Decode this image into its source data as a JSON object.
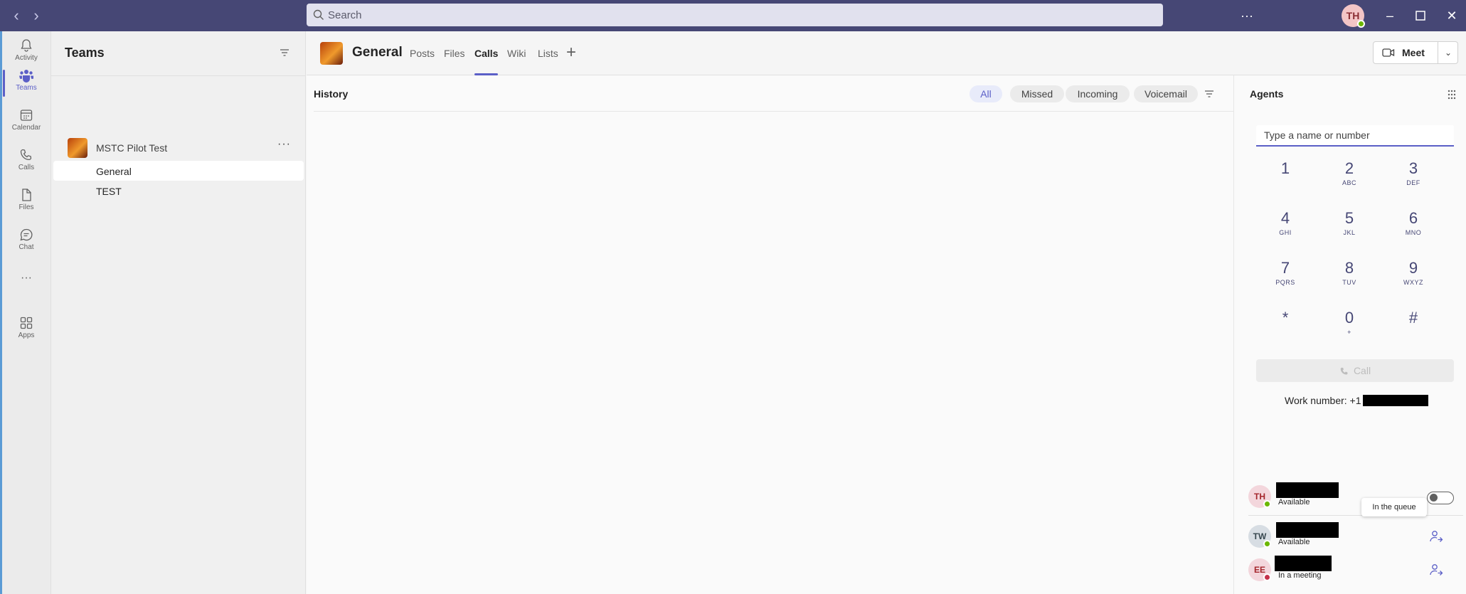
{
  "search": {
    "placeholder": "Search"
  },
  "me": {
    "initials": "TH"
  },
  "rail": [
    {
      "id": "activity",
      "label": "Activity"
    },
    {
      "id": "teams",
      "label": "Teams"
    },
    {
      "id": "calendar",
      "label": "Calendar"
    },
    {
      "id": "calls",
      "label": "Calls"
    },
    {
      "id": "files",
      "label": "Files"
    },
    {
      "id": "chat",
      "label": "Chat"
    },
    {
      "id": "more",
      "label": "···"
    },
    {
      "id": "apps",
      "label": "Apps"
    }
  ],
  "teams_pane": {
    "title": "Teams",
    "team": {
      "name": "MSTC Pilot Test",
      "more": "···"
    },
    "channels": [
      "General",
      "TEST"
    ]
  },
  "channel": {
    "title": "General",
    "tabs": [
      "Posts",
      "Files",
      "Calls",
      "Wiki",
      "Lists"
    ],
    "active_tab": "Calls",
    "add_tab": "+",
    "meet_label": "Meet"
  },
  "history": {
    "title": "History",
    "filters": [
      "All",
      "Missed",
      "Incoming",
      "Voicemail"
    ],
    "active_filter": "All"
  },
  "agents": {
    "title": "Agents",
    "dial_placeholder": "Type a name or number",
    "keys": [
      {
        "digit": "1",
        "letters": ""
      },
      {
        "digit": "2",
        "letters": "ABC"
      },
      {
        "digit": "3",
        "letters": "DEF"
      },
      {
        "digit": "4",
        "letters": "GHI"
      },
      {
        "digit": "5",
        "letters": "JKL"
      },
      {
        "digit": "6",
        "letters": "MNO"
      },
      {
        "digit": "7",
        "letters": "PQRS"
      },
      {
        "digit": "8",
        "letters": "TUV"
      },
      {
        "digit": "9",
        "letters": "WXYZ"
      },
      {
        "digit": "*",
        "letters": ""
      },
      {
        "digit": "0",
        "letters": "+"
      },
      {
        "digit": "#",
        "letters": ""
      }
    ],
    "call_label": "Call",
    "work_number_label": "Work number: +1",
    "list": [
      {
        "initials": "TH",
        "status": "Available",
        "presence": "available"
      },
      {
        "initials": "TW",
        "status": "Available",
        "presence": "available"
      },
      {
        "initials": "EE",
        "status": "In a meeting",
        "presence": "busy"
      }
    ],
    "tooltip": "In the queue"
  },
  "colors": {
    "titlebar": "#464775",
    "accent": "#5b5fc7",
    "available": "#6bb700",
    "busy": "#c4314b"
  }
}
